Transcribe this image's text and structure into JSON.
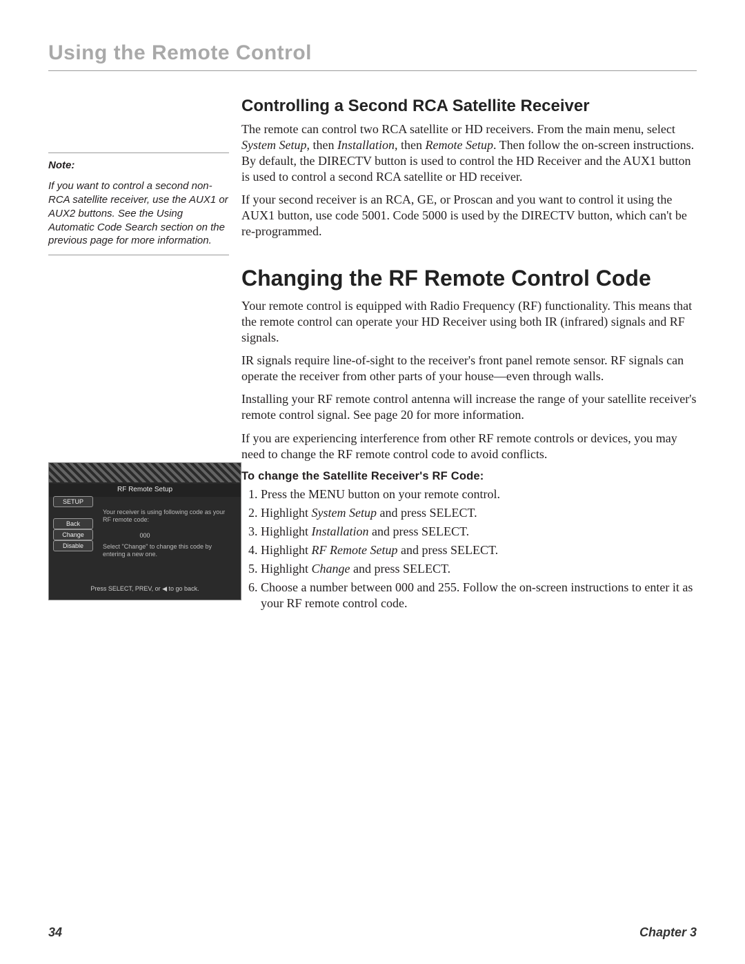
{
  "page_header": "Using the Remote Control",
  "sidebar": {
    "note_title": "Note:",
    "note_body": "If you want to control a second non-RCA satellite receiver, use the AUX1 or AUX2 buttons. See the Using Automatic Code Search section on the previous page for more information."
  },
  "screenshot": {
    "title": "RF Remote Setup",
    "btn_setup": "SETUP",
    "btn_back": "Back",
    "btn_change": "Change",
    "btn_disable": "Disable",
    "msg1": "Your receiver is using following code as your RF remote code:",
    "code": "000",
    "msg2": "Select \"Change\" to change this code by entering a new one.",
    "hint": "Press SELECT, PREV, or ◀ to go back."
  },
  "main": {
    "sub1_title": "Controlling a Second RCA Satellite Receiver",
    "sub1_p1_a": "The remote can control two RCA satellite or HD receivers. From the main menu, select ",
    "sub1_p1_i1": "System Setup",
    "sub1_p1_b": ", then ",
    "sub1_p1_i2": "Installation",
    "sub1_p1_c": ", then ",
    "sub1_p1_i3": "Remote Setup",
    "sub1_p1_d": ". Then follow the on-screen instructions. By default, the DIRECTV button is used to control the HD Receiver and the AUX1 button is used to control a second RCA satellite or HD receiver.",
    "sub1_p2": "If your second receiver is an RCA, GE, or Proscan and you want to control it using the AUX1 button, use code 5001. Code 5000 is used by the DIRECTV button, which can't be re-programmed.",
    "sec1_title": "Changing the RF Remote Control Code",
    "sec1_p1": "Your remote control is equipped with Radio Frequency (RF) functionality. This means that the remote control can operate your HD Receiver using both IR (infrared) signals and RF signals.",
    "sec1_p2": "IR signals require line-of-sight to the receiver's front panel remote sensor. RF signals can operate the receiver from other parts of your house—even through walls.",
    "sec1_p3": "Installing your RF remote control antenna will increase the range of your satellite receiver's remote control signal. See page 20 for more information.",
    "sec1_p4": "If you are experiencing interference from other RF remote controls or devices, you may need to change the RF remote control code to avoid conflicts.",
    "proc_title": "To change the Satellite Receiver's RF Code:",
    "steps": {
      "s1": "Press the MENU button on your remote control.",
      "s2a": "Highlight ",
      "s2i": "System Setup",
      "s2b": " and press SELECT.",
      "s3a": "Highlight ",
      "s3i": "Installation",
      "s3b": " and press SELECT.",
      "s4a": "Highlight ",
      "s4i": "RF Remote Setup",
      "s4b": " and press SELECT.",
      "s5a": "Highlight ",
      "s5i": "Change",
      "s5b": " and press SELECT.",
      "s6": "Choose a number between 000 and 255. Follow the on-screen instructions to enter it as your RF remote control code."
    }
  },
  "footer": {
    "page": "34",
    "chapter": "Chapter 3"
  }
}
